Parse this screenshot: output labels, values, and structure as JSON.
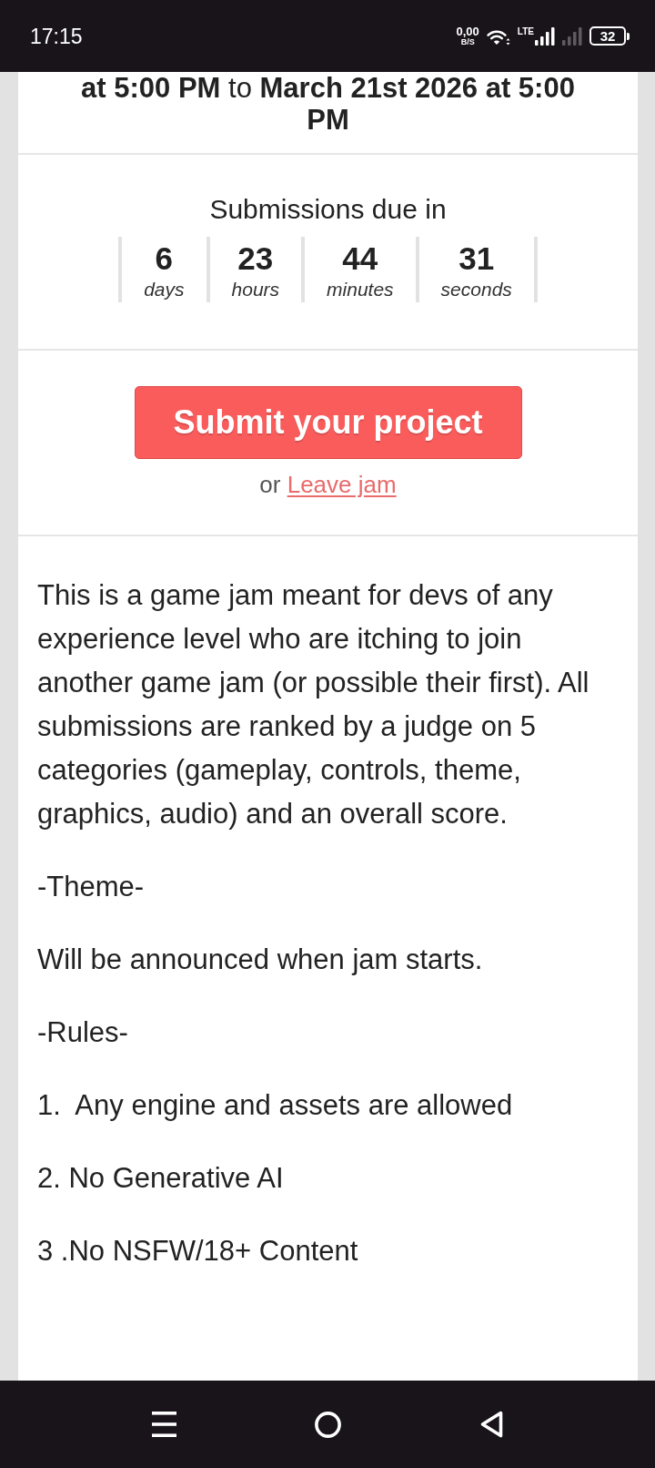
{
  "status_bar": {
    "time": "17:15",
    "speed_value": "0,00",
    "speed_unit": "B/S",
    "network_type": "LTE",
    "battery": "32"
  },
  "schedule": {
    "text": "**at 5:00 PM** to **March 21st 2026 at 5:00 PM**"
  },
  "countdown": {
    "title": "Submissions due in",
    "units": [
      {
        "value": "6",
        "unit": "days"
      },
      {
        "value": "23",
        "unit": "hours"
      },
      {
        "value": "44",
        "unit": "minutes"
      },
      {
        "value": "31",
        "unit": "seconds"
      }
    ]
  },
  "actions": {
    "submit_button": "Submit your project",
    "leave_prefix": "or",
    "leave_link": "Leave jam"
  },
  "description": [
    "This is a game jam meant for devs of any experience level who are itching to join another game jam (or possible their first). All submissions are ranked by a judge on 5 categories (gameplay, controls, theme, graphics, audio) and an overall score.",
    "-Theme-",
    "Will be announced when jam starts.",
    "-Rules-",
    "1.  Any engine and assets are allowed",
    "2. No Generative AI",
    "3 .No NSFW/18+ Content"
  ]
}
